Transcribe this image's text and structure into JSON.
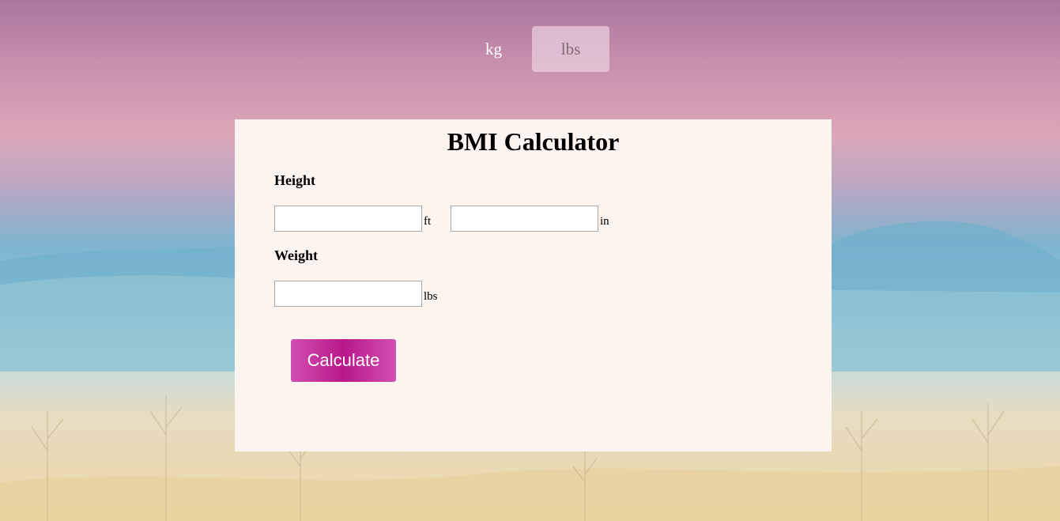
{
  "units": {
    "kg_label": "kg",
    "lbs_label": "lbs",
    "selected": "lbs"
  },
  "calculator": {
    "title": "BMI Calculator",
    "height": {
      "label": "Height",
      "feet_value": "",
      "feet_unit": "ft",
      "inches_value": "",
      "inches_unit": "in"
    },
    "weight": {
      "label": "Weight",
      "value": "",
      "unit": "lbs"
    },
    "calculate_label": "Calculate"
  },
  "colors": {
    "card_background": "#fcf5ef",
    "button_accent": "#b8188a",
    "button_light": "#d24fb0"
  },
  "background": {
    "scene": "pastel-mountain-landscape"
  }
}
